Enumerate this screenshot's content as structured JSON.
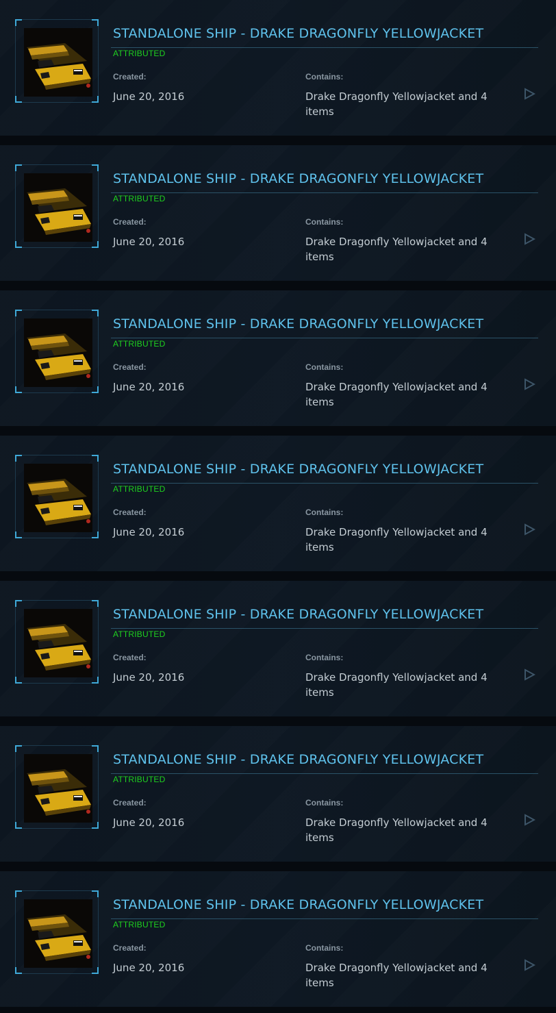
{
  "colors": {
    "title": "#5fc2ec",
    "status": "#1fd11f",
    "label": "#8a97a2",
    "value": "#c4cdd3",
    "accent": "#3fa9d8"
  },
  "pledges": [
    {
      "title": "STANDALONE SHIP - DRAKE DRAGONFLY YELLOWJACKET",
      "status": "ATTRIBUTED",
      "created_label": "Created:",
      "created_value": "June 20, 2016",
      "contains_label": "Contains:",
      "contains_value": "Drake Dragonfly Yellowjacket and 4 items",
      "thumbnail_icon": "ship-thumbnail-icon",
      "open_icon": "play-arrow-icon"
    },
    {
      "title": "STANDALONE SHIP - DRAKE DRAGONFLY YELLOWJACKET",
      "status": "ATTRIBUTED",
      "created_label": "Created:",
      "created_value": "June 20, 2016",
      "contains_label": "Contains:",
      "contains_value": "Drake Dragonfly Yellowjacket and 4 items",
      "thumbnail_icon": "ship-thumbnail-icon",
      "open_icon": "play-arrow-icon"
    },
    {
      "title": "STANDALONE SHIP - DRAKE DRAGONFLY YELLOWJACKET",
      "status": "ATTRIBUTED",
      "created_label": "Created:",
      "created_value": "June 20, 2016",
      "contains_label": "Contains:",
      "contains_value": "Drake Dragonfly Yellowjacket and 4 items",
      "thumbnail_icon": "ship-thumbnail-icon",
      "open_icon": "play-arrow-icon"
    },
    {
      "title": "STANDALONE SHIP - DRAKE DRAGONFLY YELLOWJACKET",
      "status": "ATTRIBUTED",
      "created_label": "Created:",
      "created_value": "June 20, 2016",
      "contains_label": "Contains:",
      "contains_value": "Drake Dragonfly Yellowjacket and 4 items",
      "thumbnail_icon": "ship-thumbnail-icon",
      "open_icon": "play-arrow-icon"
    },
    {
      "title": "STANDALONE SHIP - DRAKE DRAGONFLY YELLOWJACKET",
      "status": "ATTRIBUTED",
      "created_label": "Created:",
      "created_value": "June 20, 2016",
      "contains_label": "Contains:",
      "contains_value": "Drake Dragonfly Yellowjacket and 4 items",
      "thumbnail_icon": "ship-thumbnail-icon",
      "open_icon": "play-arrow-icon"
    },
    {
      "title": "STANDALONE SHIP - DRAKE DRAGONFLY YELLOWJACKET",
      "status": "ATTRIBUTED",
      "created_label": "Created:",
      "created_value": "June 20, 2016",
      "contains_label": "Contains:",
      "contains_value": "Drake Dragonfly Yellowjacket and 4 items",
      "thumbnail_icon": "ship-thumbnail-icon",
      "open_icon": "play-arrow-icon"
    },
    {
      "title": "STANDALONE SHIP - DRAKE DRAGONFLY YELLOWJACKET",
      "status": "ATTRIBUTED",
      "created_label": "Created:",
      "created_value": "June 20, 2016",
      "contains_label": "Contains:",
      "contains_value": "Drake Dragonfly Yellowjacket and 4 items",
      "thumbnail_icon": "ship-thumbnail-icon",
      "open_icon": "play-arrow-icon"
    }
  ]
}
